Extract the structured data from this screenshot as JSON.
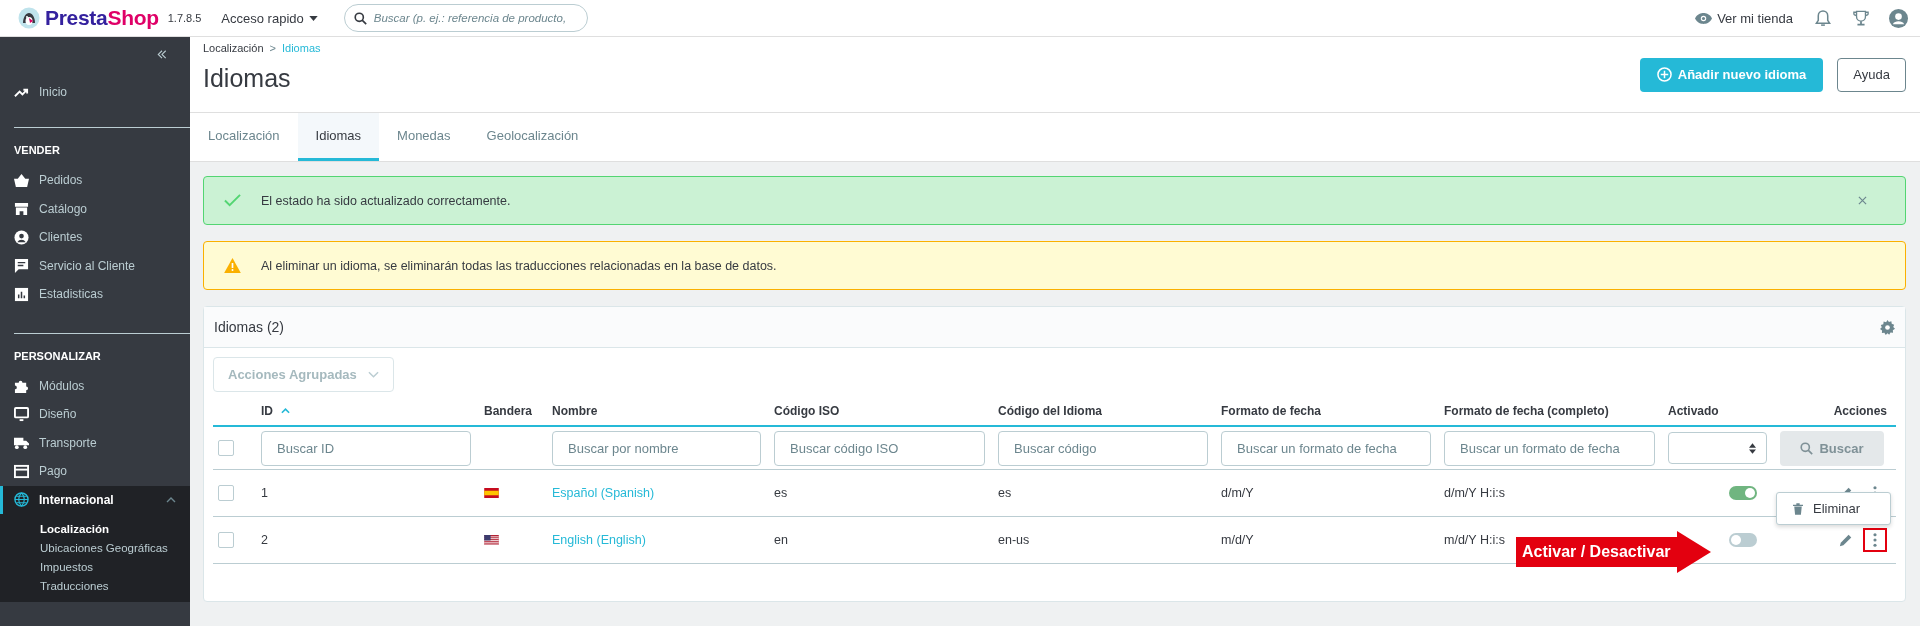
{
  "header": {
    "logo": {
      "parts": [
        "Presta",
        "Shop"
      ]
    },
    "version": "1.7.8.5",
    "quick_access": "Acceso rapido",
    "search": {
      "placeholder": "Buscar (p. ej.: referencia de producto,"
    },
    "view_store": "Ver mi tienda"
  },
  "sidebar": {
    "sections": [
      {
        "items": [
          {
            "label": "Inicio",
            "selected": false
          }
        ]
      },
      {
        "title": "VENDER",
        "items": [
          {
            "label": "Pedidos",
            "selected": false
          },
          {
            "label": "Catálogo",
            "selected": false
          },
          {
            "label": "Clientes",
            "selected": false
          },
          {
            "label": "Servicio al Cliente",
            "selected": false
          },
          {
            "label": "Estadisticas",
            "selected": false
          }
        ]
      },
      {
        "title": "PERSONALIZAR",
        "items": [
          {
            "label": "Módulos",
            "selected": false
          },
          {
            "label": "Diseño",
            "selected": false
          },
          {
            "label": "Transporte",
            "selected": false
          },
          {
            "label": "Pago",
            "selected": false
          },
          {
            "label": "Internacional",
            "selected": true,
            "expanded": true,
            "children": [
              {
                "label": "Localización",
                "selected": true
              },
              {
                "label": "Ubicaciones Geográficas",
                "selected": false
              },
              {
                "label": "Impuestos",
                "selected": false
              },
              {
                "label": "Traducciones",
                "selected": false
              }
            ]
          }
        ]
      }
    ]
  },
  "page": {
    "breadcrumb_separator": ">",
    "breadcrumb": [
      {
        "label": "Localización",
        "selected": false
      },
      {
        "label": "Idiomas",
        "selected": true
      }
    ],
    "title": "Idiomas",
    "buttons": [
      {
        "label": "Añadir nuevo idioma",
        "kind": "primary"
      },
      {
        "label": "Ayuda",
        "kind": "outline"
      }
    ],
    "tabs": [
      {
        "label": "Localización",
        "selected": false
      },
      {
        "label": "Idiomas",
        "selected": true
      },
      {
        "label": "Monedas",
        "selected": false
      },
      {
        "label": "Geolocalización",
        "selected": false
      }
    ]
  },
  "alerts": [
    {
      "kind": "success",
      "text": "El estado ha sido actualizado correctamente.",
      "dismissible": true
    },
    {
      "kind": "warning",
      "text": "Al eliminar un idioma, se eliminarán todas las traducciones relacionadas en la base de datos.",
      "dismissible": false
    }
  ],
  "panel": {
    "title": "Idiomas (2)",
    "bulk_actions": "Acciones Agrupadas",
    "columns": [
      {
        "label": "ID",
        "sorted": true
      },
      {
        "label": "Bandera",
        "sorted": false
      },
      {
        "label": "Nombre",
        "sorted": false
      },
      {
        "label": "Código ISO",
        "sorted": false
      },
      {
        "label": "Código del Idioma",
        "sorted": false
      },
      {
        "label": "Formato de fecha",
        "sorted": false
      },
      {
        "label": "Formato de fecha (completo)",
        "sorted": false
      },
      {
        "label": "Activado",
        "sorted": false
      },
      {
        "label": "Acciones",
        "sorted": false
      }
    ],
    "select_all": {
      "checked": false
    },
    "filters": [
      {
        "kind": "text",
        "placeholder": "Buscar ID"
      },
      {
        "kind": "none"
      },
      {
        "kind": "text",
        "placeholder": "Buscar por nombre"
      },
      {
        "kind": "text",
        "placeholder": "Buscar código ISO"
      },
      {
        "kind": "text",
        "placeholder": "Buscar código"
      },
      {
        "kind": "text",
        "placeholder": "Buscar un formato de fecha"
      },
      {
        "kind": "text",
        "placeholder": "Buscar un formato de fecha"
      },
      {
        "kind": "select"
      },
      {
        "kind": "button",
        "label": "Buscar",
        "disabled": true
      }
    ],
    "rows": [
      {
        "checked": false,
        "id": "1",
        "name": "Español (Spanish)",
        "iso": "es",
        "language_code": "es",
        "date_format": "d/m/Y",
        "date_format_full": "d/m/Y H:i:s",
        "active": true,
        "menu_open": true,
        "menu_highlighted": false
      },
      {
        "checked": false,
        "id": "2",
        "name": "English (English)",
        "iso": "en",
        "language_code": "en-us",
        "date_format": "m/d/Y",
        "date_format_full": "m/d/Y H:i:s",
        "active": false,
        "menu_open": false,
        "menu_highlighted": true
      }
    ],
    "row_menu": [
      {
        "label": "Eliminar"
      }
    ]
  },
  "callout": {
    "text": "Activar / Desactivar"
  }
}
